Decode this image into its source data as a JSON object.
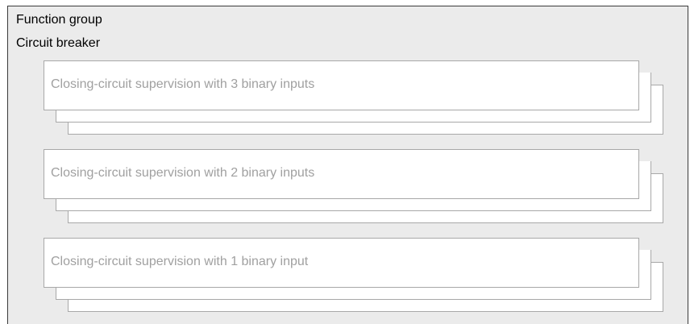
{
  "function_group": {
    "caption": "Function group",
    "name": "Circuit breaker"
  },
  "functions": [
    {
      "label": "Closing-circuit supervision with 3 binary inputs"
    },
    {
      "label": "Closing-circuit supervision with 2 binary inputs"
    },
    {
      "label": "Closing-circuit supervision with 1 binary input"
    }
  ],
  "colors": {
    "panel_background": "#ebebeb",
    "panel_border": "#3a3a3a",
    "card_background": "#ffffff",
    "card_border": "#a8a8a8",
    "card_text": "#a0a0a0"
  }
}
